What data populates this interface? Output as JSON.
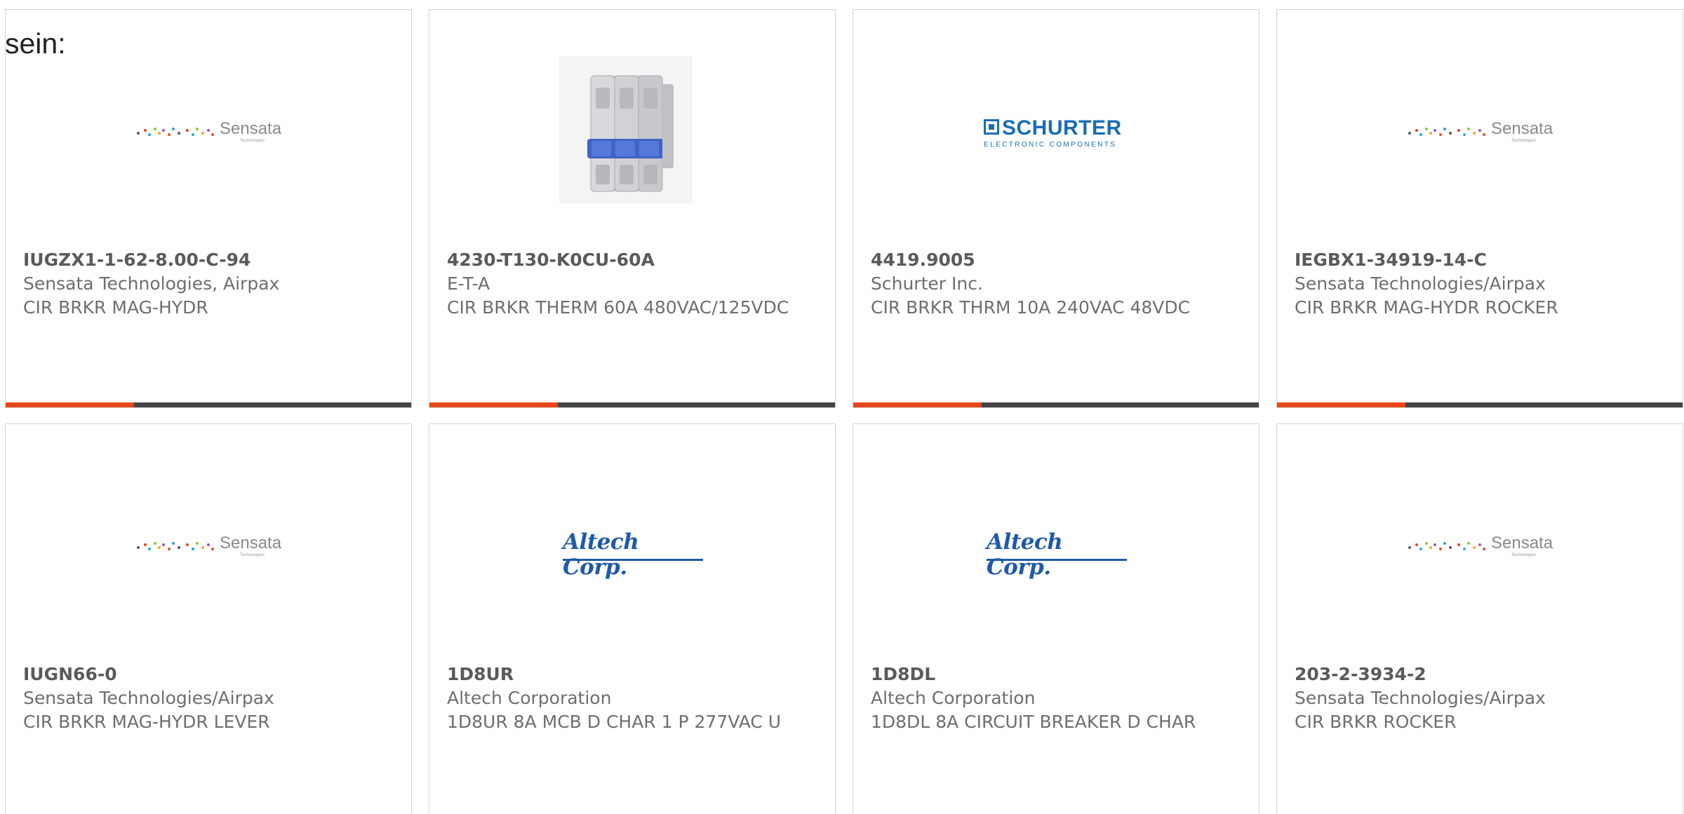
{
  "intro_text": "sein:",
  "colors": {
    "accent_bar": "#e8461b",
    "dark_bar": "#444444",
    "card_border": "#d3d3d3",
    "text_gray": "#6e6e6e",
    "sensata_gray": "#8a8a8a",
    "schurter_blue": "#1a6db5",
    "altech_blue": "#1f5aa8"
  },
  "logos": {
    "sensata": {
      "word": "Sensata",
      "sub": "Technologies"
    },
    "schurter": {
      "name": "SCHURTER",
      "tag": "ELECTRONIC COMPONENTS"
    },
    "altech": {
      "name": "Altech Corp."
    }
  },
  "products": [
    {
      "image": "sensata-logo",
      "part_number": "IUGZX1-1-62-8.00-C-94",
      "manufacturer": "Sensata Technologies, Airpax",
      "description": "CIR BRKR MAG-HYDR"
    },
    {
      "image": "circuit-breaker-photo",
      "part_number": "4230-T130-K0CU-60A",
      "manufacturer": "E-T-A",
      "description": "CIR BRKR THERM 60A 480VAC/125VDC"
    },
    {
      "image": "schurter-logo",
      "part_number": "4419.9005",
      "manufacturer": "Schurter Inc.",
      "description": "CIR BRKR THRM 10A 240VAC 48VDC"
    },
    {
      "image": "sensata-logo",
      "part_number": "IEGBX1-34919-14-C",
      "manufacturer": "Sensata Technologies/Airpax",
      "description": "CIR BRKR MAG-HYDR ROCKER"
    },
    {
      "image": "sensata-logo",
      "part_number": "IUGN66-0",
      "manufacturer": "Sensata Technologies/Airpax",
      "description": "CIR BRKR MAG-HYDR LEVER"
    },
    {
      "image": "altech-logo",
      "part_number": "1D8UR",
      "manufacturer": "Altech Corporation",
      "description": "1D8UR 8A MCB D CHAR 1 P 277VAC U"
    },
    {
      "image": "altech-logo",
      "part_number": "1D8DL",
      "manufacturer": "Altech Corporation",
      "description": "1D8DL 8A CIRCUIT BREAKER D CHAR"
    },
    {
      "image": "sensata-logo",
      "part_number": "203-2-3934-2",
      "manufacturer": "Sensata Technologies/Airpax",
      "description": "CIR BRKR ROCKER"
    }
  ]
}
